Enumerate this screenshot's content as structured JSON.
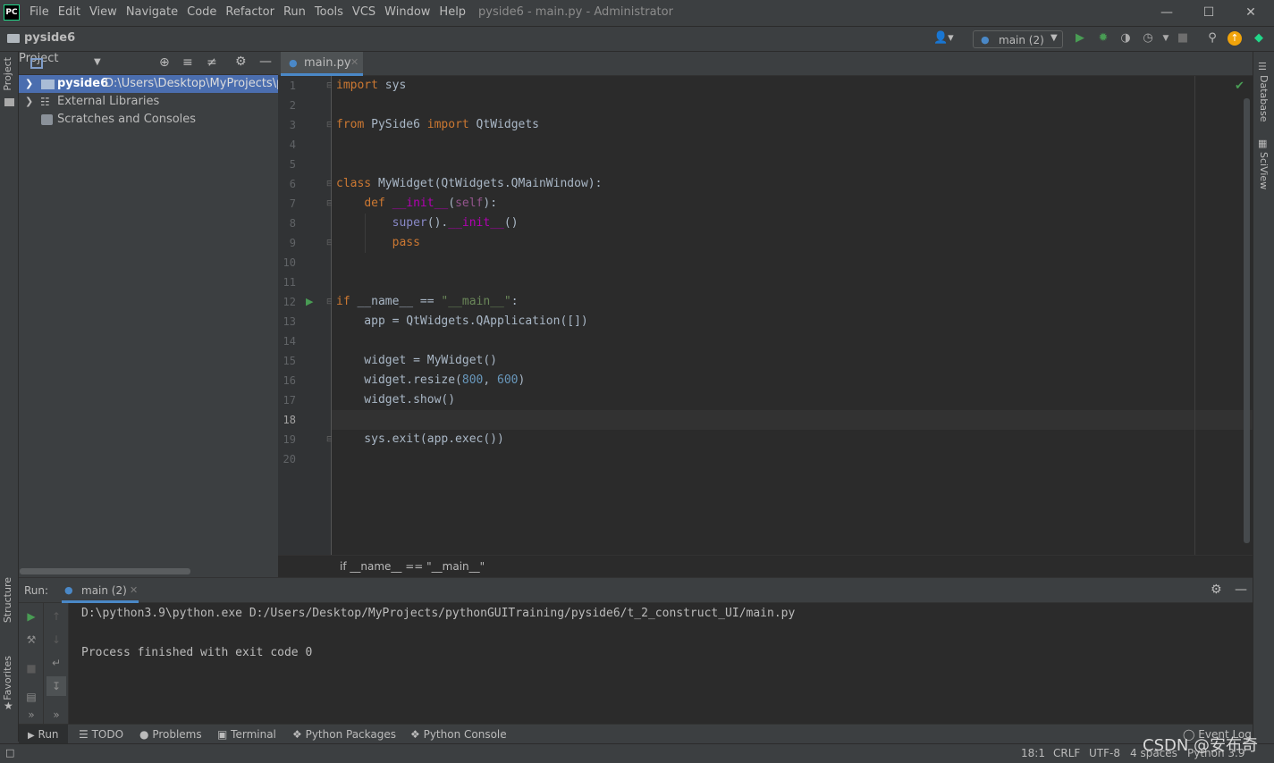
{
  "app": {
    "logo": "PC",
    "window_title": "pyside6 - main.py - Administrator",
    "menu": [
      "File",
      "Edit",
      "View",
      "Navigate",
      "Code",
      "Refactor",
      "Run",
      "Tools",
      "VCS",
      "Window",
      "Help"
    ]
  },
  "navbar": {
    "project_name": "pyside6",
    "run_config": "main (2)"
  },
  "project_panel": {
    "title": "Project",
    "tree": [
      {
        "name": "pyside6",
        "path": "D:\\Users\\Desktop\\MyProjects\\py"
      },
      {
        "name": "External Libraries"
      },
      {
        "name": "Scratches and Consoles"
      }
    ]
  },
  "editor": {
    "tab_name": "main.py",
    "line_numbers": [
      "1",
      "2",
      "3",
      "4",
      "5",
      "6",
      "7",
      "8",
      "9",
      "10",
      "11",
      "12",
      "13",
      "14",
      "15",
      "16",
      "17",
      "18",
      "19",
      "20"
    ],
    "current_line": "18",
    "breadcrumb": "if __name__ == \"__main__\""
  },
  "side_tabs": {
    "left": [
      "Project",
      "Structure",
      "Favorites"
    ],
    "right": [
      "Database",
      "SciView"
    ]
  },
  "run_panel": {
    "label": "Run:",
    "tab_name": "main (2)",
    "console": [
      "D:\\python3.9\\python.exe D:/Users/Desktop/MyProjects/pythonGUITraining/pyside6/t_2_construct_UI/main.py",
      "",
      "Process finished with exit code 0"
    ]
  },
  "bottom_tabs": [
    "Run",
    "TODO",
    "Problems",
    "Terminal",
    "Python Packages",
    "Python Console"
  ],
  "status": {
    "event_log": "Event Log",
    "position": "18:1",
    "line_sep": "CRLF",
    "encoding": "UTF-8",
    "indent": "4 spaces",
    "interpreter": "Python 3.9"
  },
  "watermark": "CSDN @安布奇",
  "colors": {
    "accent": "#4b6eaf",
    "keyword": "#cc7832",
    "run_green": "#499c54"
  }
}
